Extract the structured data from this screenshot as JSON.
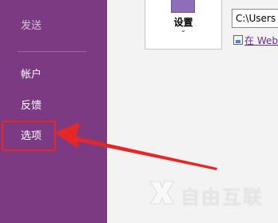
{
  "sidebar": {
    "send_label": "发送",
    "items": [
      {
        "label": "帐户"
      },
      {
        "label": "反馈"
      },
      {
        "label": "选项"
      }
    ]
  },
  "settings": {
    "label": "设置",
    "chevron": "⌄"
  },
  "path_input": {
    "value": "C:\\Users"
  },
  "web_link": {
    "label": "在 Web"
  },
  "watermark": {
    "text": "自由互联"
  },
  "colors": {
    "sidebar_bg": "#7b3a82",
    "highlight": "#e62727",
    "link": "#6b2c8f"
  }
}
